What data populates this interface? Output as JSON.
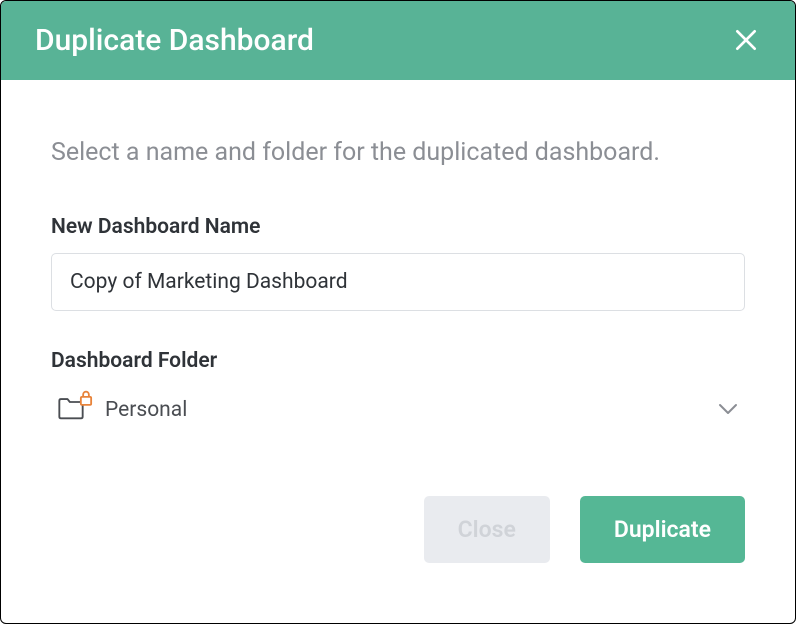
{
  "modal": {
    "title": "Duplicate Dashboard",
    "instruction": "Select a name and folder for the duplicated dashboard.",
    "name_field": {
      "label": "New Dashboard Name",
      "value": "Copy of Marketing Dashboard"
    },
    "folder_field": {
      "label": "Dashboard Folder",
      "value": "Personal"
    },
    "buttons": {
      "close": "Close",
      "duplicate": "Duplicate"
    }
  }
}
